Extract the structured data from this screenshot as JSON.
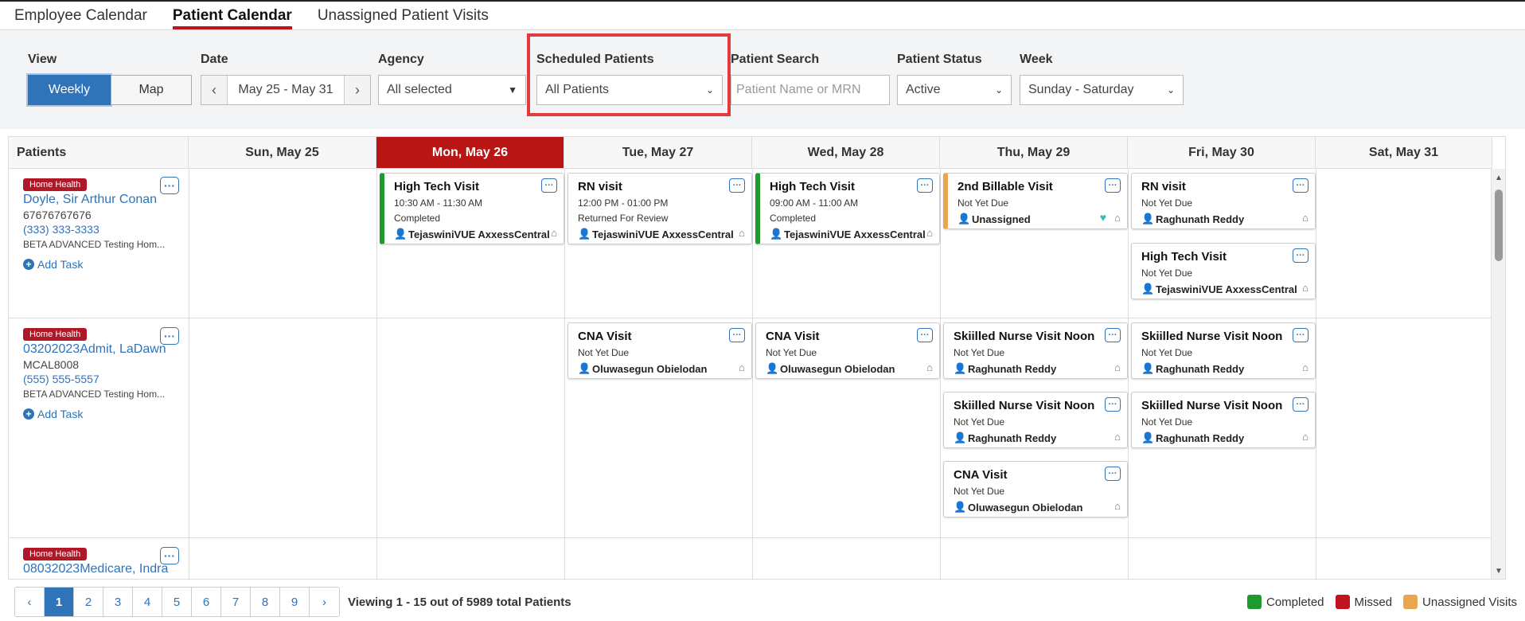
{
  "tabs": [
    {
      "label": "Employee Calendar",
      "active": false
    },
    {
      "label": "Patient Calendar",
      "active": true
    },
    {
      "label": "Unassigned Patient Visits",
      "active": false
    }
  ],
  "filters": {
    "view": {
      "label": "View",
      "options": [
        "Weekly",
        "Map"
      ],
      "selected": "Weekly"
    },
    "date": {
      "label": "Date",
      "value": "May 25 - May 31"
    },
    "agency": {
      "label": "Agency",
      "value": "All selected"
    },
    "scheduled": {
      "label": "Scheduled Patients",
      "value": "All Patients"
    },
    "search": {
      "label": "Patient Search",
      "placeholder": "Patient Name or MRN"
    },
    "status": {
      "label": "Patient Status",
      "value": "Active"
    },
    "week": {
      "label": "Week",
      "value": "Sunday - Saturday"
    }
  },
  "grid": {
    "patients_header": "Patients",
    "days": [
      "Sun, May 25",
      "Mon, May 26",
      "Tue, May 27",
      "Wed, May 28",
      "Thu, May 29",
      "Fri, May 30",
      "Sat, May 31"
    ],
    "today_index": 1
  },
  "patients": [
    {
      "badge": "Home Health",
      "name": "Doyle, Sir Arthur Conan",
      "mrn": "67676767676",
      "phone": "(333) 333-3333",
      "agency": "BETA ADVANCED Testing Hom...",
      "add_task": "Add Task"
    },
    {
      "badge": "Home Health",
      "name": "03202023Admit, LaDawn",
      "mrn": "MCAL8008",
      "phone": "(555) 555-5557",
      "agency": "BETA ADVANCED Testing Hom...",
      "add_task": "Add Task"
    },
    {
      "badge": "Home Health",
      "name": "08032023Medicare, Indra"
    }
  ],
  "visits": [
    {
      "title": "High Tech Visit",
      "time": "10:30 AM - 11:30 AM",
      "status": "Completed",
      "user": "TejaswiniVUE AxxessCentral",
      "status_color": "completed"
    },
    {
      "title": "RN visit",
      "time": "12:00 PM - 01:00 PM",
      "status": "Returned For Review",
      "user": "TejaswiniVUE AxxessCentral",
      "status_color": "none"
    },
    {
      "title": "High Tech Visit",
      "time": "09:00 AM - 11:00 AM",
      "status": "Completed",
      "user": "TejaswiniVUE AxxessCentral",
      "status_color": "completed"
    },
    {
      "title": "2nd Billable Visit",
      "status": "Not Yet Due",
      "user": "Unassigned",
      "status_color": "unassigned"
    },
    {
      "title": "RN visit",
      "status": "Not Yet Due",
      "user": "Raghunath Reddy",
      "status_color": "none"
    },
    {
      "title": "High Tech Visit",
      "status": "Not Yet Due",
      "user": "TejaswiniVUE AxxessCentral",
      "status_color": "none"
    },
    {
      "title": "CNA Visit",
      "status": "Not Yet Due",
      "user": "Oluwasegun Obielodan",
      "status_color": "none"
    },
    {
      "title": "CNA Visit",
      "status": "Not Yet Due",
      "user": "Oluwasegun Obielodan",
      "status_color": "none"
    },
    {
      "title": "Skiilled Nurse Visit Noon",
      "status": "Not Yet Due",
      "user": "Raghunath Reddy",
      "status_color": "none"
    },
    {
      "title": "Skiilled Nurse Visit Noon",
      "status": "Not Yet Due",
      "user": "Raghunath Reddy",
      "status_color": "none"
    },
    {
      "title": "Skiilled Nurse Visit Noon",
      "status": "Not Yet Due",
      "user": "Raghunath Reddy",
      "status_color": "none"
    },
    {
      "title": "Skiilled Nurse Visit Noon",
      "status": "Not Yet Due",
      "user": "Raghunath Reddy",
      "status_color": "none"
    },
    {
      "title": "CNA Visit",
      "status": "Not Yet Due",
      "user": "Oluwasegun Obielodan",
      "status_color": "none"
    }
  ],
  "pagination": {
    "pages": [
      "1",
      "2",
      "3",
      "4",
      "5",
      "6",
      "7",
      "8",
      "9"
    ],
    "current": "1",
    "summary": "Viewing 1 - 15 out of 5989 total Patients"
  },
  "legend": [
    {
      "label": "Completed",
      "color": "#1f9a2e"
    },
    {
      "label": "Missed",
      "color": "#c0121c"
    },
    {
      "label": "Unassigned Visits",
      "color": "#e8a64f"
    }
  ],
  "icons": {
    "prev": "chevron-left-icon",
    "next": "chevron-right-icon",
    "dropdown": "caret-down-icon",
    "more": "ellipsis-icon",
    "home": "home-icon",
    "person": "person-icon",
    "heart": "heart-icon",
    "add": "plus-circle-icon"
  }
}
